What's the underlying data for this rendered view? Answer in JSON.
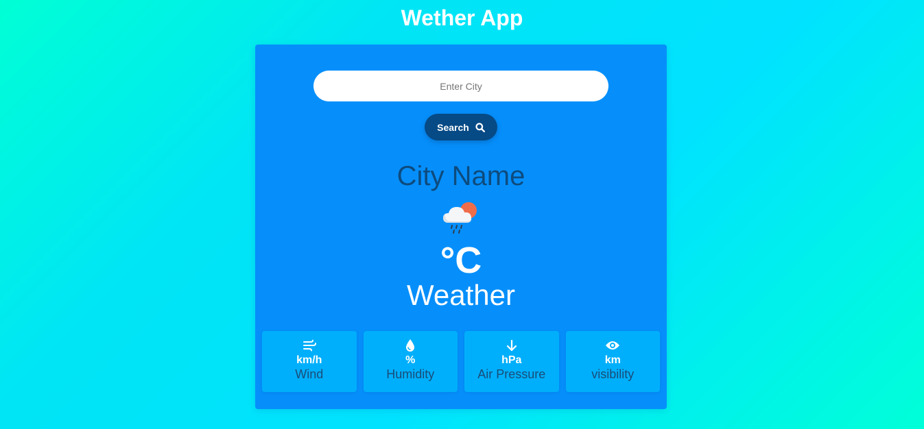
{
  "app": {
    "title": "Wether App"
  },
  "search": {
    "placeholder": "Enter City",
    "value": "",
    "button_label": "Search",
    "button_icon": "search-icon"
  },
  "weather": {
    "city": "City Name",
    "icon": "cloud-rain-sun-icon",
    "temperature": "°C",
    "description": "Weather"
  },
  "stats": [
    {
      "icon": "wind-icon",
      "value": "km/h",
      "label": "Wind"
    },
    {
      "icon": "droplet-icon",
      "value": "%",
      "label": "Humidity"
    },
    {
      "icon": "arrow-down-icon",
      "value": "hPa",
      "label": "Air Pressure"
    },
    {
      "icon": "eye-icon",
      "value": "km",
      "label": "visibility"
    }
  ],
  "colors": {
    "card_bg": "#068ffb",
    "stat_bg": "#00affc",
    "button_bg": "#064a86",
    "city_text": "#0d4b7e",
    "label_text": "#1a4d78"
  }
}
